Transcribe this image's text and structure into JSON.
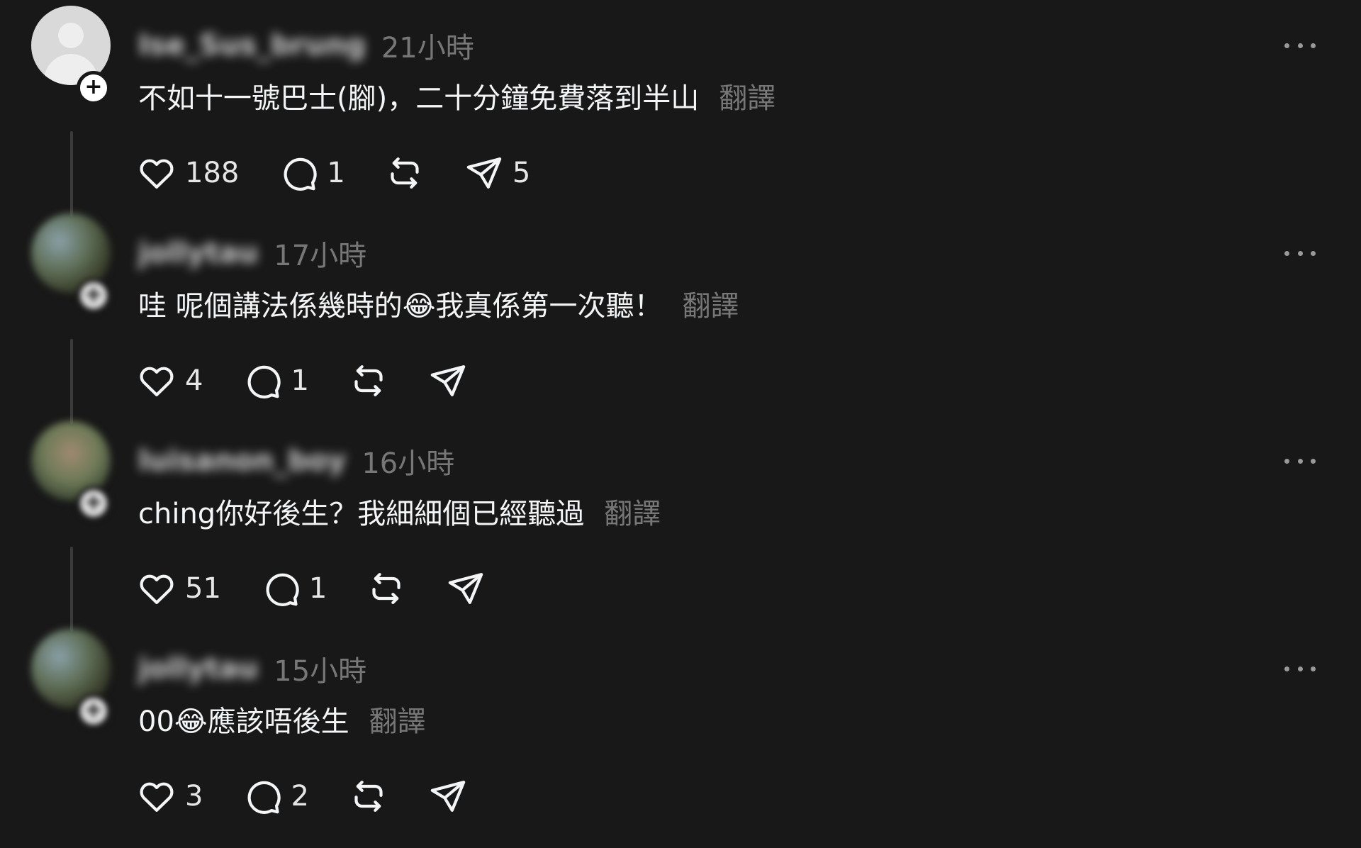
{
  "comments": [
    {
      "username": "Ise_Sus_brung",
      "time": "21小時",
      "text": "不如十一號巴士(腳)，二十分鐘免費落到半山",
      "translate": "翻譯",
      "likes": "188",
      "replies": "1",
      "shares": "5"
    },
    {
      "username": "jollytau",
      "time": "17小時",
      "text": "哇 呢個講法係幾時的😂我真係第一次聽！",
      "translate": "翻譯",
      "likes": "4",
      "replies": "1",
      "shares": ""
    },
    {
      "username": "luisanon_boy",
      "time": "16小時",
      "text": "ching你好後生？我細細個已經聽過",
      "translate": "翻譯",
      "likes": "51",
      "replies": "1",
      "shares": ""
    },
    {
      "username": "jollytau",
      "time": "15小時",
      "text": "00😂應該唔後生",
      "translate": "翻譯",
      "likes": "3",
      "replies": "2",
      "shares": ""
    }
  ],
  "icons": {
    "like": "heart-icon",
    "reply": "comment-bubble-icon",
    "repost": "repost-icon",
    "share": "send-icon",
    "more": "more-dots-icon",
    "follow": "plus-icon"
  },
  "colors": {
    "background": "#181818",
    "text": "#f3f5f7",
    "muted": "#777777"
  }
}
